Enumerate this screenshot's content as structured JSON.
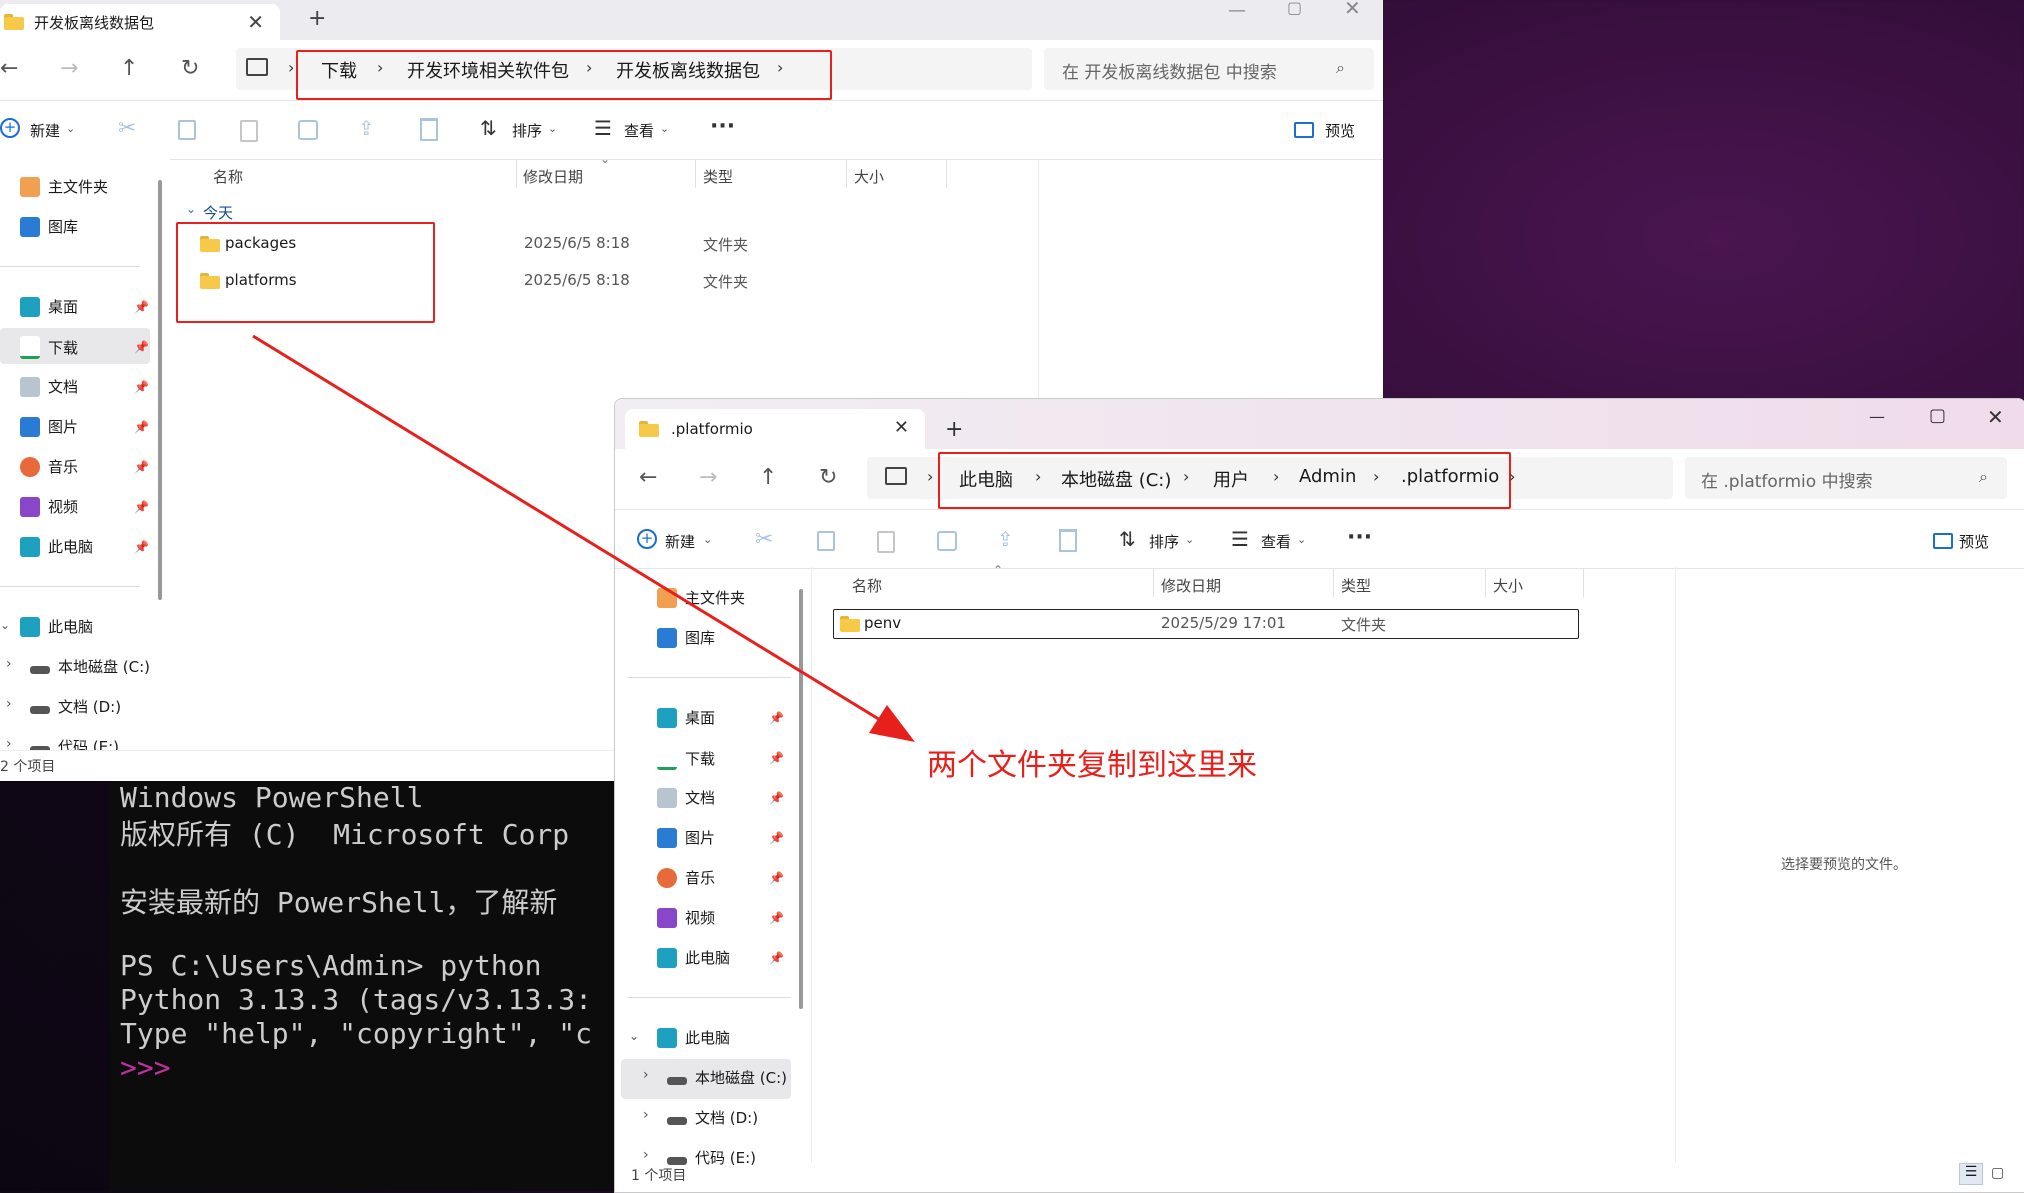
{
  "window1": {
    "tab_title": "开发板离线数据包",
    "address": [
      "下载",
      "开发环境相关软件包",
      "开发板离线数据包"
    ],
    "search_placeholder": "在 开发板离线数据包 中搜索",
    "toolbar": {
      "new": "新建",
      "sort": "排序",
      "view": "查看",
      "more": "···",
      "preview": "预览"
    },
    "nav": [
      {
        "label": "主文件夹",
        "icon": "home-icon"
      },
      {
        "label": "图库",
        "icon": "gallery-icon"
      },
      {
        "label": "桌面",
        "icon": "desktop-icon"
      },
      {
        "label": "下载",
        "icon": "download-icon"
      },
      {
        "label": "文档",
        "icon": "document-icon"
      },
      {
        "label": "图片",
        "icon": "pictures-icon"
      },
      {
        "label": "音乐",
        "icon": "music-icon"
      },
      {
        "label": "视频",
        "icon": "video-icon"
      },
      {
        "label": "此电脑",
        "icon": "computer-icon"
      },
      {
        "label": "此电脑",
        "icon": "computer-icon"
      },
      {
        "label": "本地磁盘 (C:)",
        "icon": "drive-icon"
      },
      {
        "label": "文档 (D:)",
        "icon": "drive-icon"
      },
      {
        "label": "代码 (E:)",
        "icon": "drive-icon"
      }
    ],
    "columns": [
      "名称",
      "修改日期",
      "类型",
      "大小"
    ],
    "group": "今天",
    "rows": [
      {
        "name": "packages",
        "date": "2025/6/5 8:18",
        "type": "文件夹"
      },
      {
        "name": "platforms",
        "date": "2025/6/5 8:18",
        "type": "文件夹"
      }
    ],
    "status": "2 个项目"
  },
  "window2": {
    "tab_title": ".platformio",
    "address": [
      "此电脑",
      "本地磁盘 (C:)",
      "用户",
      "Admin",
      ".platformio"
    ],
    "search_placeholder": "在 .platformio 中搜索",
    "toolbar": {
      "new": "新建",
      "sort": "排序",
      "view": "查看",
      "more": "···",
      "preview": "预览"
    },
    "nav": [
      {
        "label": "主文件夹",
        "icon": "home-icon"
      },
      {
        "label": "图库",
        "icon": "gallery-icon"
      },
      {
        "label": "桌面",
        "icon": "desktop-icon"
      },
      {
        "label": "下载",
        "icon": "download-icon"
      },
      {
        "label": "文档",
        "icon": "document-icon"
      },
      {
        "label": "图片",
        "icon": "pictures-icon"
      },
      {
        "label": "音乐",
        "icon": "music-icon"
      },
      {
        "label": "视频",
        "icon": "video-icon"
      },
      {
        "label": "此电脑",
        "icon": "computer-icon"
      },
      {
        "label": "此电脑",
        "icon": "computer-icon"
      },
      {
        "label": "本地磁盘 (C:)",
        "icon": "drive-icon"
      },
      {
        "label": "文档 (D:)",
        "icon": "drive-icon"
      },
      {
        "label": "代码 (E:)",
        "icon": "drive-icon"
      }
    ],
    "columns": [
      "名称",
      "修改日期",
      "类型",
      "大小"
    ],
    "rows": [
      {
        "name": "penv",
        "date": "2025/5/29 17:01",
        "type": "文件夹"
      }
    ],
    "preview_hint": "选择要预览的文件。",
    "status": "1 个项目"
  },
  "terminal": {
    "lines": [
      "Windows PowerShell",
      "版权所有 (C)  Microsoft Corp",
      "",
      "安装最新的 PowerShell，了解新",
      "",
      "PS C:\\Users\\Admin> python",
      "Python 3.13.3 (tags/v3.13.3:",
      "Type \"help\", \"copyright\", \"c",
      ">>>"
    ]
  },
  "annotation": {
    "text": "两个文件夹复制到这里来",
    "color": "#e8201c"
  }
}
